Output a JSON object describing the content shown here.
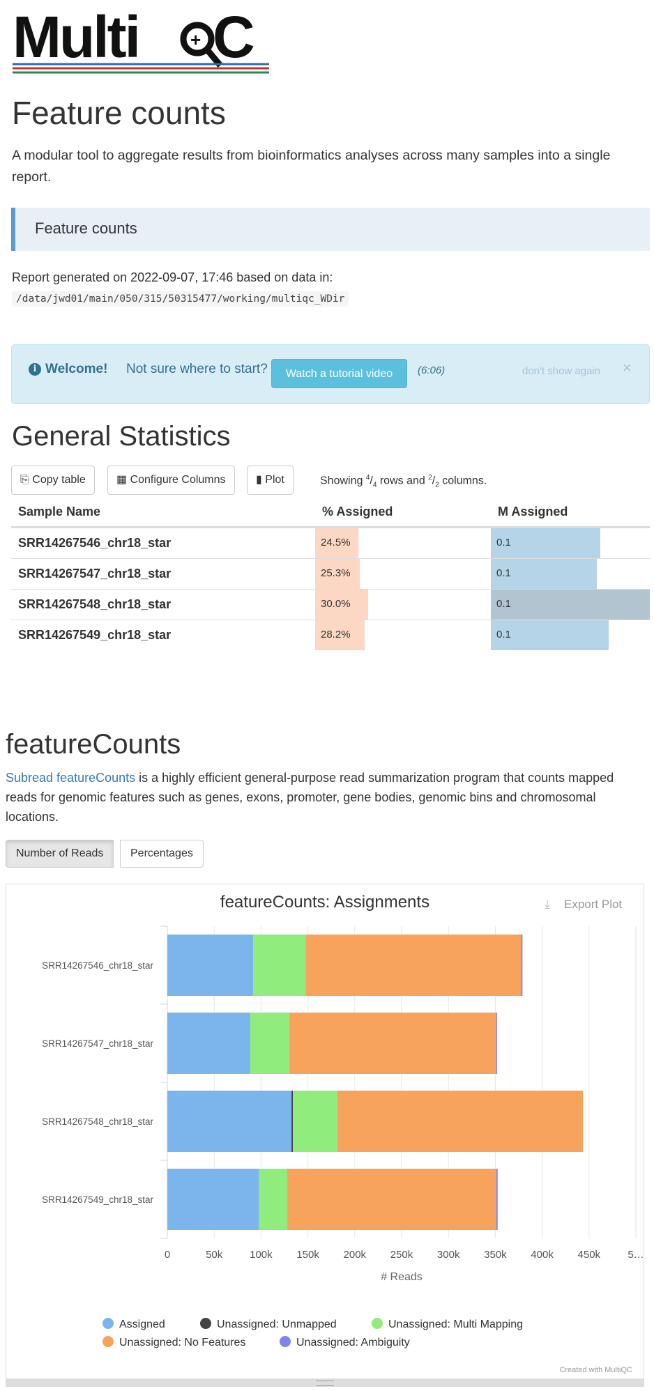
{
  "logo": {
    "text": "MultiQC"
  },
  "header": {
    "title": "Feature counts",
    "intro": "A modular tool to aggregate results from bioinformatics analyses across many samples into a single report.",
    "subtitle": "Feature counts",
    "report_line": "Report generated on 2022-09-07, 17:46 based on data in:",
    "report_path": "/data/jwd01/main/050/315/50315477/working/multiqc_WDir"
  },
  "welcome": {
    "icon": "info-circle-icon",
    "bold": "Welcome!",
    "question": "Not sure where to start?",
    "button": "Watch a tutorial video",
    "duration": "(6:06)",
    "dismiss": "don't show again",
    "close": "×"
  },
  "general_stats": {
    "title": "General Statistics",
    "buttons": {
      "copy": "Copy table",
      "configure": "Configure Columns",
      "plot": "Plot"
    },
    "showing": {
      "prefix": "Showing ",
      "rows_num": "4",
      "rows_den": "4",
      "mid": " rows and ",
      "cols_num": "2",
      "cols_den": "2",
      "suffix": " columns."
    },
    "columns": [
      "Sample Name",
      "% Assigned",
      "M Assigned"
    ],
    "rows": [
      {
        "sample": "SRR14267546_chr18_star",
        "pct": "24.5%",
        "pct_value": 24.5,
        "m": "0.1",
        "m_value": 0.0915
      },
      {
        "sample": "SRR14267547_chr18_star",
        "pct": "25.3%",
        "pct_value": 25.3,
        "m": "0.1",
        "m_value": 0.0885
      },
      {
        "sample": "SRR14267548_chr18_star",
        "pct": "30.0%",
        "pct_value": 30.0,
        "m": "0.1",
        "m_value": 0.1325
      },
      {
        "sample": "SRR14267549_chr18_star",
        "pct": "28.2%",
        "pct_value": 28.2,
        "m": "0.1",
        "m_value": 0.098
      }
    ],
    "colors": {
      "pct": "#fbd7c4",
      "m": "#b6d4e8",
      "m_highlight": "#b3c4d1"
    }
  },
  "featurecounts": {
    "title": "featureCounts",
    "link_text": "Subread featureCounts",
    "description": " is a highly efficient general-purpose read summarization program that counts mapped reads for genomic features such as genes, exons, promoter, gene bodies, genomic bins and chromosomal locations.",
    "tabs": [
      "Number of Reads",
      "Percentages"
    ],
    "export": "Export Plot",
    "credit": "Created with MultiQC"
  },
  "chart_data": {
    "type": "bar",
    "orientation": "horizontal",
    "stacked": true,
    "title": "featureCounts: Assignments",
    "xlabel": "# Reads",
    "ylabel": "",
    "xlim": [
      0,
      500000
    ],
    "xticks": [
      "0",
      "50k",
      "100k",
      "150k",
      "200k",
      "250k",
      "300k",
      "350k",
      "400k",
      "450k",
      "5…"
    ],
    "categories": [
      "SRR14267546_chr18_star",
      "SRR14267547_chr18_star",
      "SRR14267548_chr18_star",
      "SRR14267549_chr18_star"
    ],
    "series": [
      {
        "name": "Assigned",
        "color": "#7cb5ec",
        "values": [
          91500,
          88500,
          132500,
          98000
        ]
      },
      {
        "name": "Unassigned: Unmapped",
        "color": "#434348",
        "values": [
          0,
          0,
          1500,
          0
        ]
      },
      {
        "name": "Unassigned: Multi Mapping",
        "color": "#90ed7d",
        "values": [
          56000,
          41500,
          47500,
          30000
        ]
      },
      {
        "name": "Unassigned: No Features",
        "color": "#f7a35c",
        "values": [
          230000,
          221000,
          262000,
          223000
        ]
      },
      {
        "name": "Unassigned: Ambiguity",
        "color": "#8085e9",
        "values": [
          1500,
          1000,
          0,
          1500
        ]
      }
    ],
    "grid": true,
    "legend": "bottom"
  }
}
